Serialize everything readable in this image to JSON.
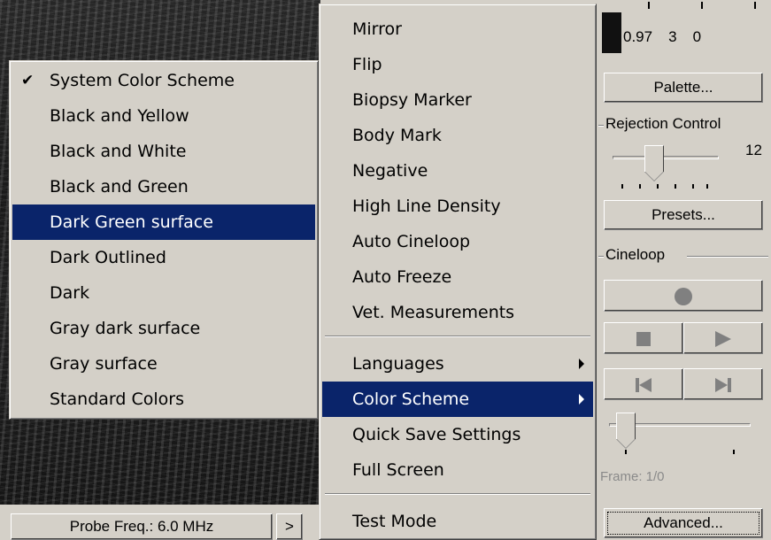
{
  "probe_bar": {
    "label": "Probe Freq.: 6.0 MHz",
    "next_label": ">"
  },
  "panel": {
    "values": [
      "0.97",
      "3",
      "0"
    ],
    "palette_label": "Palette...",
    "rejection_label": "Rejection Control",
    "rejection_value": "12",
    "presets_label": "Presets...",
    "cineloop_label": "Cineloop",
    "frame_label": "Frame: 1/0",
    "advanced_label": "Advanced..."
  },
  "main_menu": {
    "items": [
      {
        "label": "Mirror"
      },
      {
        "label": "Flip"
      },
      {
        "label": "Biopsy Marker"
      },
      {
        "label": "Body Mark"
      },
      {
        "label": "Negative"
      },
      {
        "label": "High Line Density"
      },
      {
        "label": "Auto Cineloop"
      },
      {
        "label": "Auto Freeze"
      },
      {
        "label": "Vet. Measurements"
      },
      {
        "label": "Languages"
      },
      {
        "label": "Color Scheme"
      },
      {
        "label": "Quick Save Settings"
      },
      {
        "label": "Full Screen"
      },
      {
        "label": "Test Mode"
      }
    ]
  },
  "color_menu": {
    "check_glyph": "✔",
    "items": [
      {
        "label": "System Color Scheme"
      },
      {
        "label": "Black and Yellow"
      },
      {
        "label": "Black and White"
      },
      {
        "label": "Black and Green"
      },
      {
        "label": "Dark Green surface"
      },
      {
        "label": "Dark Outlined"
      },
      {
        "label": "Dark"
      },
      {
        "label": "Gray dark surface"
      },
      {
        "label": "Gray surface"
      },
      {
        "label": "Standard Colors"
      }
    ]
  },
  "colors": {
    "highlight": "#0a246a",
    "face": "#d4d0c8"
  }
}
